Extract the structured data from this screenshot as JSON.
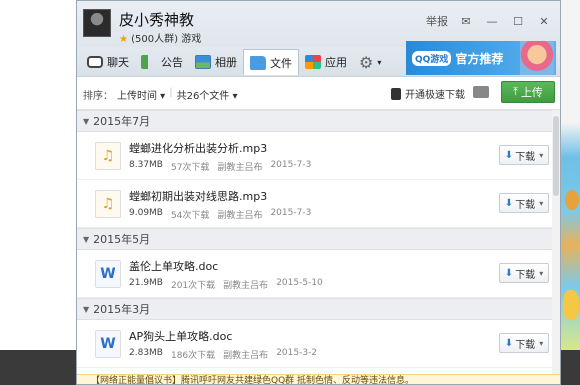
{
  "group": {
    "name": "皮小秀神教",
    "subtitle": "(500人群) 游戏"
  },
  "window_controls": {
    "report": "举报",
    "settings": "✉",
    "minimize": "—",
    "maximize": "☐",
    "close": "✕"
  },
  "tabs": [
    {
      "label": "聊天",
      "icon": "chat-icon"
    },
    {
      "label": "公告",
      "icon": "notice-icon"
    },
    {
      "label": "相册",
      "icon": "photo-icon"
    },
    {
      "label": "文件",
      "icon": "file-icon",
      "active": true
    },
    {
      "label": "应用",
      "icon": "app-icon"
    }
  ],
  "banner": {
    "badge": "QQ游戏",
    "text": "官方推荐"
  },
  "toolbar": {
    "sort_label": "排序：",
    "sort_value": "上传时间",
    "count": "共26个文件",
    "fast_download": "开通极速下载",
    "upload": "上传"
  },
  "sections": [
    {
      "title": "2015年7月",
      "files": [
        {
          "name": "螳螂进化分析出装分析.mp3",
          "type": "mp3",
          "size": "8.37MB",
          "downloads": "57次下载",
          "uploader": "副教主吕布",
          "date": "2015-7-3"
        },
        {
          "name": "螳螂初期出装对线思路.mp3",
          "type": "mp3",
          "size": "9.09MB",
          "downloads": "54次下载",
          "uploader": "副教主吕布",
          "date": "2015-7-3"
        }
      ]
    },
    {
      "title": "2015年5月",
      "files": [
        {
          "name": "盖伦上单攻略.doc",
          "type": "doc",
          "size": "21.9MB",
          "downloads": "201次下载",
          "uploader": "副教主吕布",
          "date": "2015-5-10"
        }
      ]
    },
    {
      "title": "2015年3月",
      "files": [
        {
          "name": "AP狗头上单攻略.doc",
          "type": "doc",
          "size": "2.83MB",
          "downloads": "186次下载",
          "uploader": "副教主吕布",
          "date": "2015-3-2"
        }
      ]
    }
  ],
  "download_label": "下载",
  "notice": "【网络正能量倡议书】腾讯呼吁网友共建绿色QQ群 抵制色情、反动等违法信息。"
}
